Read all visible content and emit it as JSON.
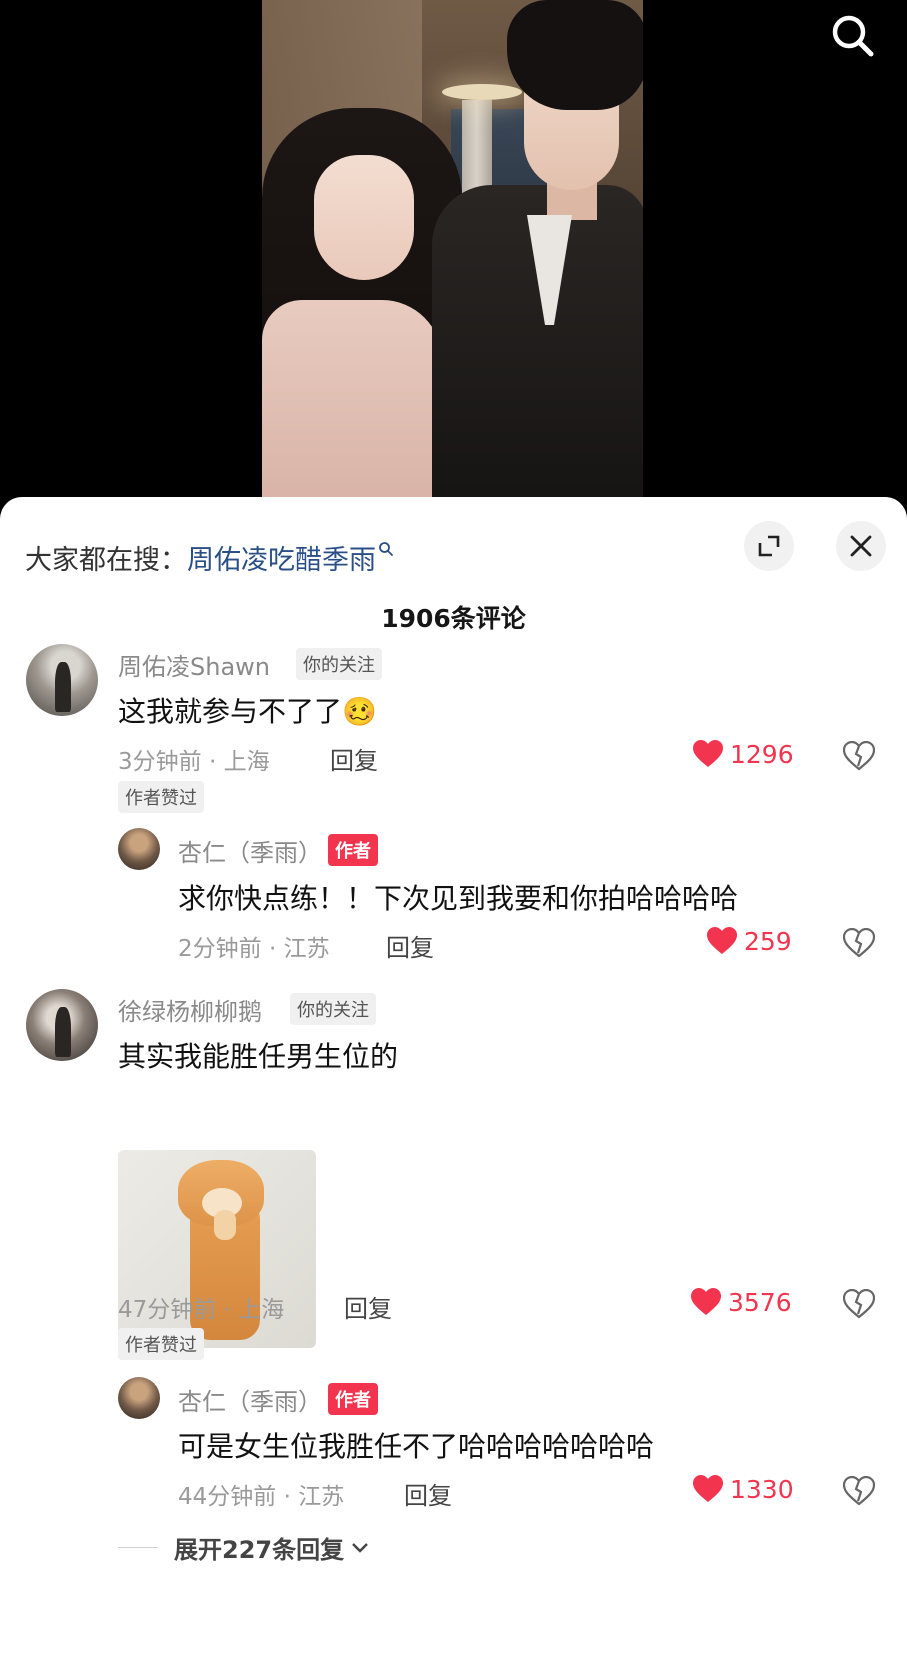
{
  "search_hint": {
    "prefix": "大家都在搜：",
    "term": "周佑凌吃醋季雨"
  },
  "comment_count": "1906条评论",
  "comments": [
    {
      "user": "周佑凌Shawn",
      "badge": "你的关注",
      "text": "这我就参与不了了",
      "emoji": "🥴",
      "meta": "3分钟前 · 上海",
      "reply_label": "回复",
      "likes": "1296",
      "author_liked": "作者赞过",
      "replies": [
        {
          "user": "杏仁（季雨）",
          "badge": "作者",
          "text": "求你快点练！！下次见到我要和你拍哈哈哈哈",
          "meta": "2分钟前 · 江苏",
          "reply_label": "回复",
          "likes": "259"
        }
      ]
    },
    {
      "user": "徐绿杨柳柳鹅",
      "badge": "你的关注",
      "text": "其实我能胜任男生位的",
      "meta": "47分钟前 · 上海",
      "reply_label": "回复",
      "likes": "3576",
      "author_liked": "作者赞过",
      "replies": [
        {
          "user": "杏仁（季雨）",
          "badge": "作者",
          "text": "可是女生位我胜任不了哈哈哈哈哈哈哈",
          "meta": "44分钟前 · 江苏",
          "reply_label": "回复",
          "likes": "1330"
        }
      ],
      "expand_label": "展开227条回复"
    }
  ],
  "colors": {
    "like_red": "#f2344f",
    "search_term_blue": "#2a4f86"
  },
  "icons": [
    "search-icon",
    "expand-icon",
    "close-icon",
    "heart-icon",
    "dislike-icon",
    "chevron-down-icon"
  ]
}
